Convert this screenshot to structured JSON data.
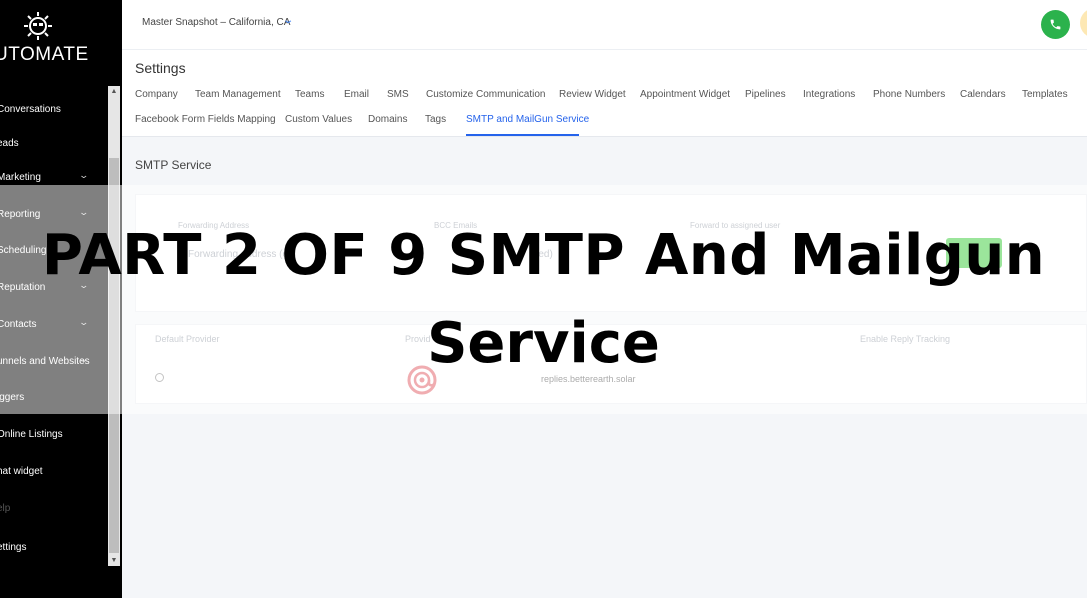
{
  "brand": {
    "name": "UTOMATE"
  },
  "sidebar": {
    "items": [
      {
        "label": "Conversations",
        "has_chevron": false
      },
      {
        "label": "eads",
        "has_chevron": false
      },
      {
        "label": "Marketing",
        "has_chevron": true
      },
      {
        "label": "Reporting",
        "has_chevron": true
      },
      {
        "label": "Scheduling",
        "has_chevron": false
      },
      {
        "label": "Reputation",
        "has_chevron": true
      },
      {
        "label": "Contacts",
        "has_chevron": true
      },
      {
        "label": "unnels and Websites",
        "has_chevron": true
      },
      {
        "label": "iggers",
        "has_chevron": false
      },
      {
        "label": "Online Listings",
        "has_chevron": false
      },
      {
        "label": "hat widget",
        "has_chevron": false
      },
      {
        "label": "elp",
        "has_chevron": false
      },
      {
        "label": "ettings",
        "has_chevron": false
      }
    ]
  },
  "topbar": {
    "location": "Master Snapshot – California, CA"
  },
  "settings": {
    "title": "Settings",
    "tabs_row1": [
      "Company",
      "Team Management",
      "Teams",
      "Email",
      "SMS",
      "Customize Communication",
      "Review Widget",
      "Appointment Widget",
      "Pipelines",
      "Integrations",
      "Phone Numbers",
      "Calendars",
      "Templates"
    ],
    "tabs_row2": [
      "Facebook Form Fields Mapping",
      "Custom Values",
      "Domains",
      "Tags",
      "SMTP and MailGun Service"
    ],
    "active_tab": "SMTP and MailGun Service"
  },
  "smtp": {
    "section_title": "SMTP Service",
    "forwarding_label": "Forwarding Address",
    "bcc_label": "BCC Emails",
    "assigned_label": "Forward to assigned user",
    "forwarding_placeholder": "Forwarding address (co",
    "bcc_placeholder": "ated)"
  },
  "providers": {
    "headers": {
      "default": "Default Provider",
      "provider": "Provid",
      "reply": "Enable Reply Tracking"
    },
    "row": {
      "domain": "replies.betterearth.solar"
    }
  },
  "overlay": {
    "line1": "PART 2 OF 9 SMTP And Mailgun",
    "line2": "Service"
  },
  "colors": {
    "accent": "#2563eb",
    "phone": "#2bb24c",
    "save": "#37ca37",
    "mailgun": "#e05a62"
  }
}
